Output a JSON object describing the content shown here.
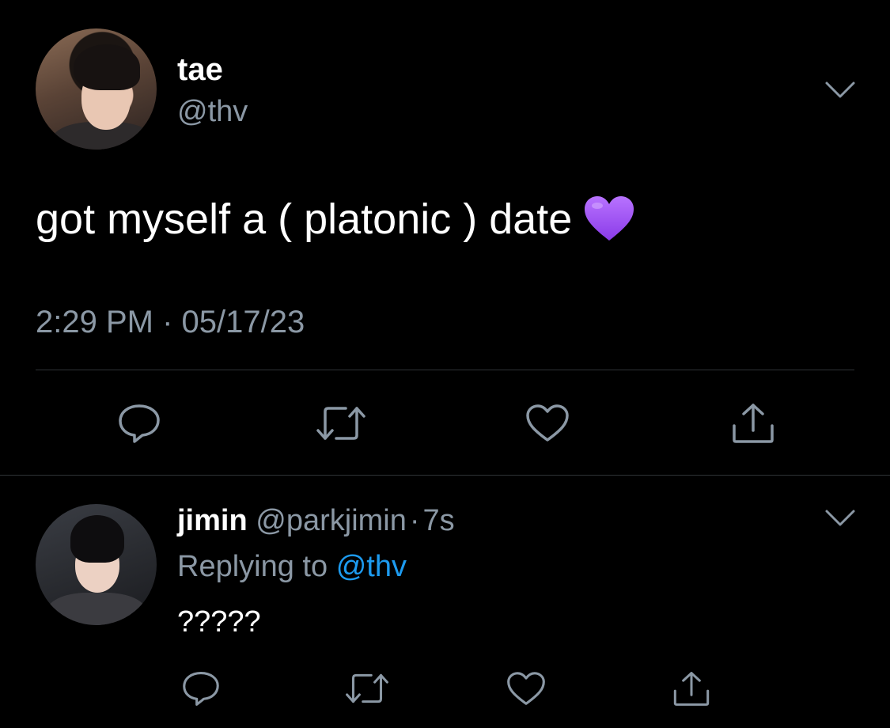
{
  "main_tweet": {
    "display_name": "tae",
    "handle": "@thv",
    "text": "got myself a ( platonic ) date",
    "emoji": "purple-heart",
    "timestamp": "2:29 PM · 05/17/23"
  },
  "reply": {
    "display_name": "jimin",
    "handle": "@parkjimin",
    "separator": "·",
    "time": "7s",
    "replying_prefix": "Replying to",
    "replying_handle": "@thv",
    "text": "?????"
  },
  "actions": [
    "reply-icon",
    "retweet-icon",
    "like-icon",
    "share-icon"
  ],
  "colors": {
    "background": "#000000",
    "text_primary": "#ffffff",
    "text_secondary": "#8b98a5",
    "link": "#1d9bf0",
    "divider": "#2f3336",
    "emoji_heart": "#9b4dff"
  }
}
